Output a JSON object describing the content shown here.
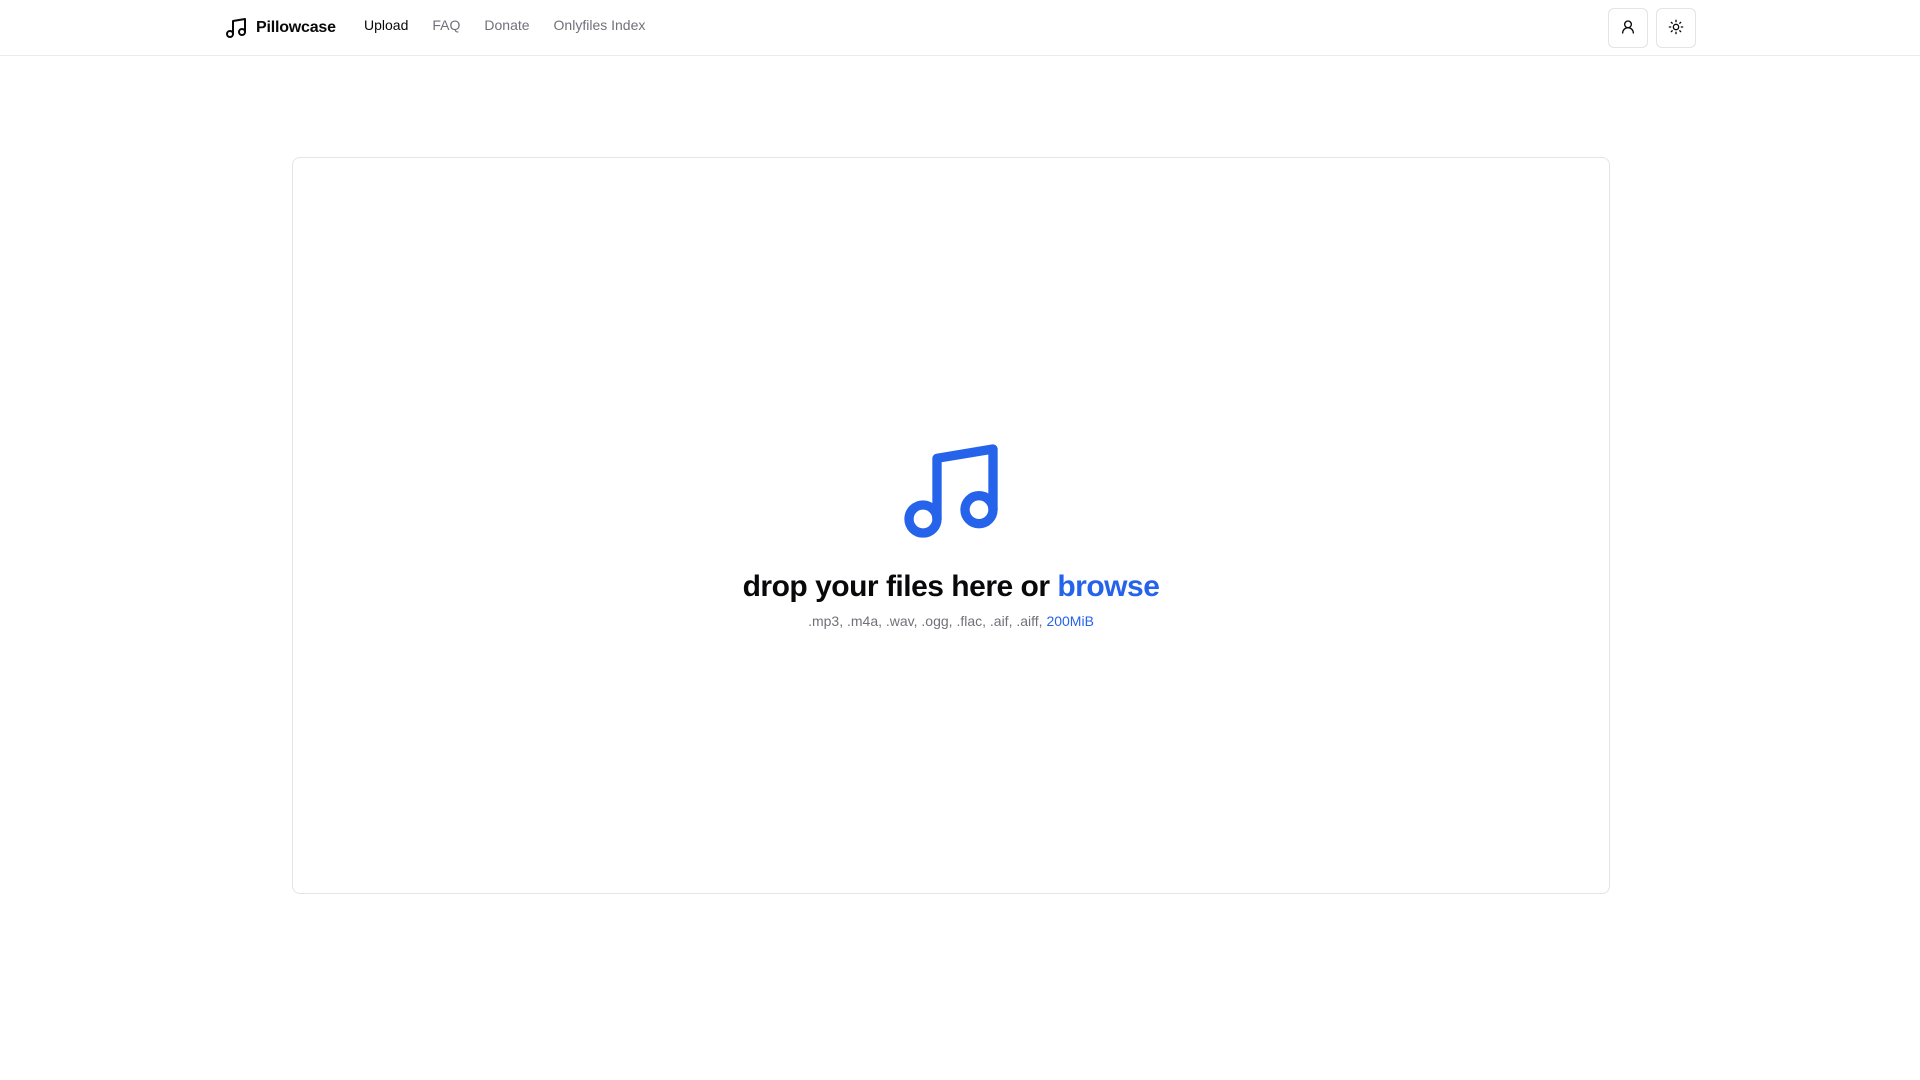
{
  "header": {
    "brand": "Pillowcase",
    "brand_icon": "music-note-icon",
    "nav": [
      {
        "label": "Upload",
        "active": true
      },
      {
        "label": "FAQ",
        "active": false
      },
      {
        "label": "Donate",
        "active": false
      },
      {
        "label": "Onlyfiles Index",
        "active": false
      }
    ],
    "actions": [
      {
        "icon": "user-icon"
      },
      {
        "icon": "sun-icon"
      }
    ]
  },
  "dropzone": {
    "icon": "music-note-icon",
    "icon_color": "#2563eb",
    "headline": "drop your files here or ",
    "browse": "browse",
    "formats": ".mp3, .m4a, .wav, .ogg, .flac, .aif, .aiff, ",
    "size_limit": "200MiB"
  },
  "colors": {
    "accent": "#2563eb",
    "text": "#09090b",
    "muted": "#71717a",
    "border": "#e4e4e7"
  }
}
